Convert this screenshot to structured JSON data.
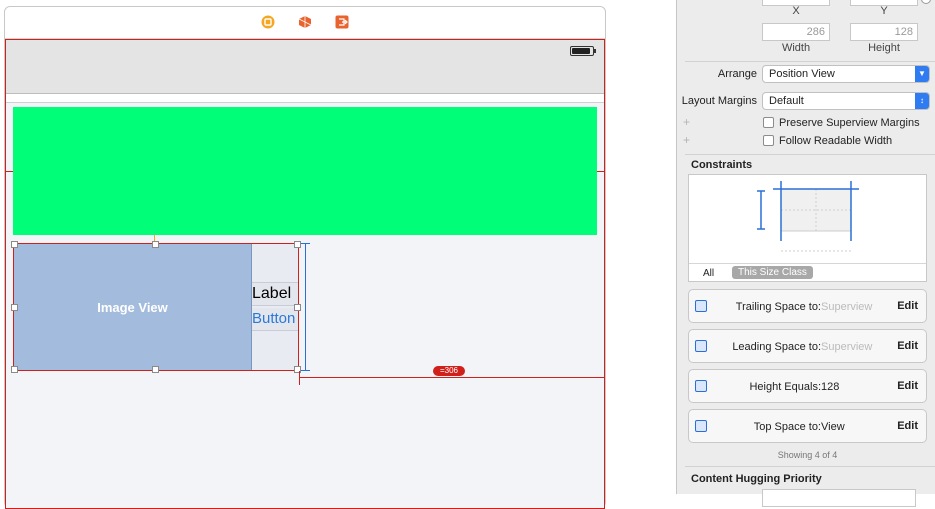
{
  "canvas": {
    "image_view_label": "Image View",
    "label_text": "Label",
    "button_text": "Button",
    "width_constraint_badge": "=306",
    "colors": {
      "green_view": "#00fe79",
      "image_view": "#a3bbdc",
      "constraint_red": "#d0201b",
      "button_blue": "#2b7ad8"
    },
    "dock_icons": [
      "view-controller-icon",
      "first-responder-icon",
      "exit-icon"
    ]
  },
  "inspector": {
    "x_caption": "X",
    "y_caption": "Y",
    "width_value": "286",
    "height_value": "128",
    "width_caption": "Width",
    "height_caption": "Height",
    "arrange_label": "Arrange",
    "arrange_value": "Position View",
    "layout_margins_label": "Layout Margins",
    "layout_margins_value": "Default",
    "preserve_superview_margins": "Preserve Superview Margins",
    "follow_readable_width": "Follow Readable Width",
    "constraints_title": "Constraints",
    "tab_all": "All",
    "tab_size_class": "This Size Class",
    "constraints": [
      {
        "label": "Trailing Space to:",
        "value": "Superview",
        "dim": true,
        "edit": "Edit"
      },
      {
        "label": "Leading Space to:",
        "value": "Superview",
        "dim": true,
        "edit": "Edit"
      },
      {
        "label": "Height Equals:",
        "value": "128",
        "dim": false,
        "edit": "Edit"
      },
      {
        "label": "Top Space to:",
        "value": "View",
        "dim": false,
        "edit": "Edit"
      }
    ],
    "showing_text": "Showing 4 of 4",
    "content_hugging_title": "Content Hugging Priority"
  }
}
